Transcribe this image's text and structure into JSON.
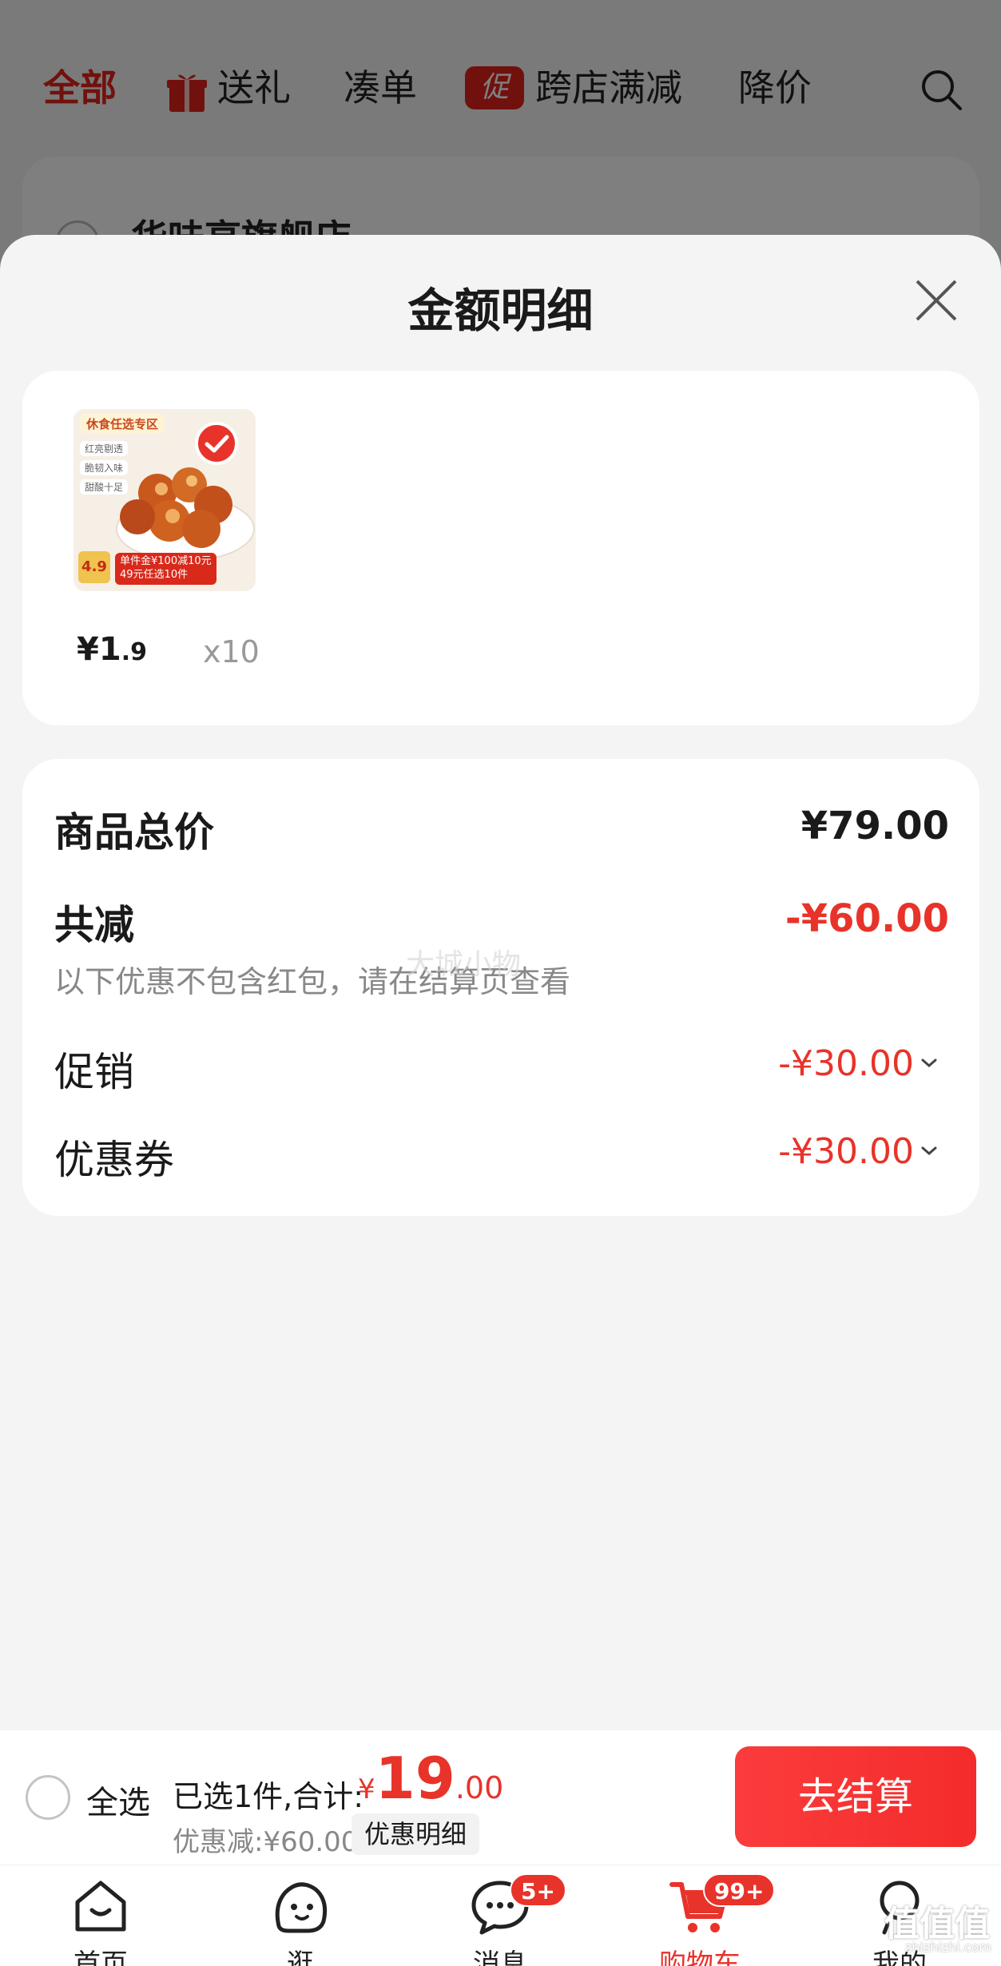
{
  "background": {
    "tabs": [
      {
        "label": "全部"
      },
      {
        "label": "送礼"
      },
      {
        "label": "凑单"
      },
      {
        "label": "跨店满减",
        "badge": "促"
      },
      {
        "label": "降价"
      }
    ],
    "store_name": "华味亨旗舰店"
  },
  "sheet": {
    "title": "金额明细",
    "product": {
      "price_symbol": "¥",
      "price_int": "1",
      "price_dec": ".9",
      "quantity": "x10",
      "thumb_badge": "休食任选专区",
      "thumb_tags": [
        "红亮剔透",
        "脆韧入味",
        "甜酸十足"
      ],
      "thumb_rating": "4.9",
      "thumb_promo_1": "单件金¥100减10元",
      "thumb_promo_2": "49元任选10件"
    },
    "details": {
      "total_label": "商品总价",
      "total_value": "¥79.00",
      "reduce_label": "共减",
      "reduce_value": "-¥60.00",
      "reduce_note": "以下优惠不包含红包，请在结算页查看",
      "promo_label": "促销",
      "promo_value": "-¥30.00",
      "coupon_label": "优惠券",
      "coupon_value": "-¥30.00",
      "watermark": "大城小物"
    }
  },
  "checkout": {
    "select_all_label": "全选",
    "selected_text": "已选1件,合计:",
    "amount_currency": "¥",
    "amount_int": "19",
    "amount_dec": ".00",
    "discount_text": "优惠减:¥60.00",
    "discount_detail_label": "优惠明细",
    "checkout_label": "去结算"
  },
  "nav": {
    "items": [
      {
        "label": "首页",
        "icon": "home-icon"
      },
      {
        "label": "逛",
        "icon": "browse-icon"
      },
      {
        "label": "消息",
        "icon": "message-icon",
        "badge": "5+"
      },
      {
        "label": "购物车",
        "icon": "cart-icon",
        "badge": "99+"
      },
      {
        "label": "我的",
        "icon": "profile-icon"
      }
    ]
  },
  "corner": {
    "logo": "值值值",
    "url": "zhizhizhi.com"
  },
  "colors": {
    "accent": "#e8332a",
    "background": "#f4f4f4"
  }
}
